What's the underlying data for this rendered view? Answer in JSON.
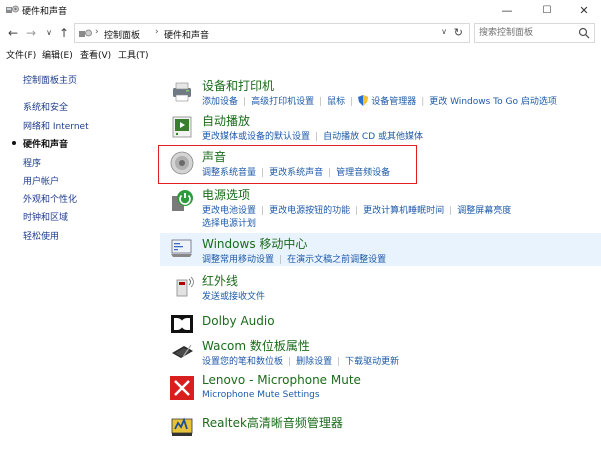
{
  "window": {
    "title": "硬件和声音",
    "controls": {
      "minimize": "—",
      "maximize": "☐",
      "close": "✕"
    }
  },
  "address": {
    "breadcrumbs": [
      "控制面板",
      "硬件和声音"
    ],
    "search_placeholder": "搜索控制面板"
  },
  "menu": [
    "文件(F)",
    "编辑(E)",
    "查看(V)",
    "工具(T)"
  ],
  "sidebar": {
    "items": [
      {
        "label": "控制面板主页"
      },
      {
        "label": "系统和安全"
      },
      {
        "label": "网络和 Internet"
      },
      {
        "label": "硬件和声音",
        "active": true
      },
      {
        "label": "程序"
      },
      {
        "label": "用户帐户"
      },
      {
        "label": "外观和个性化"
      },
      {
        "label": "时钟和区域"
      },
      {
        "label": "轻松使用"
      }
    ]
  },
  "categories": [
    {
      "title": "设备和打印机",
      "icon": "printer-icon",
      "links": [
        "添加设备",
        "高级打印机设置",
        "鼠标",
        "设备管理器",
        "更改 Windows To Go 启动选项"
      ]
    },
    {
      "title": "自动播放",
      "icon": "autoplay-icon",
      "links": [
        "更改媒体或设备的默认设置",
        "自动播放 CD 或其他媒体"
      ]
    },
    {
      "title": "声音",
      "icon": "speaker-icon",
      "links": [
        "调整系统音量",
        "更改系统声音",
        "管理音频设备"
      ]
    },
    {
      "title": "电源选项",
      "icon": "power-icon",
      "links": [
        "更改电池设置",
        "更改电源按钮的功能",
        "更改计算机睡眠时间",
        "调整屏幕亮度"
      ],
      "links2": [
        "选择电源计划"
      ]
    },
    {
      "title": "Windows 移动中心",
      "icon": "mobility-center-icon",
      "links": [
        "调整常用移动设置",
        "在演示文稿之前调整设置"
      ]
    },
    {
      "title": "红外线",
      "icon": "infrared-icon",
      "links": [
        "发送或接收文件"
      ]
    },
    {
      "title": "Dolby Audio",
      "icon": "dolby-icon",
      "links": []
    },
    {
      "title": "Wacom 数位板属性",
      "icon": "tablet-icon",
      "links": [
        "设置您的笔和数位板",
        "删除设置",
        "下载驱动更新"
      ]
    },
    {
      "title": "Lenovo - Microphone Mute",
      "icon": "mic-mute-icon",
      "links": [
        "Microphone Mute Settings"
      ]
    },
    {
      "title": "Realtek高清晰音频管理器",
      "icon": "realtek-icon",
      "links": []
    }
  ],
  "colors": {
    "category_title": "#1a6b1a",
    "link": "#1e5aaa",
    "highlight_box": "#e02020",
    "hover_row": "#e8f3fd"
  }
}
